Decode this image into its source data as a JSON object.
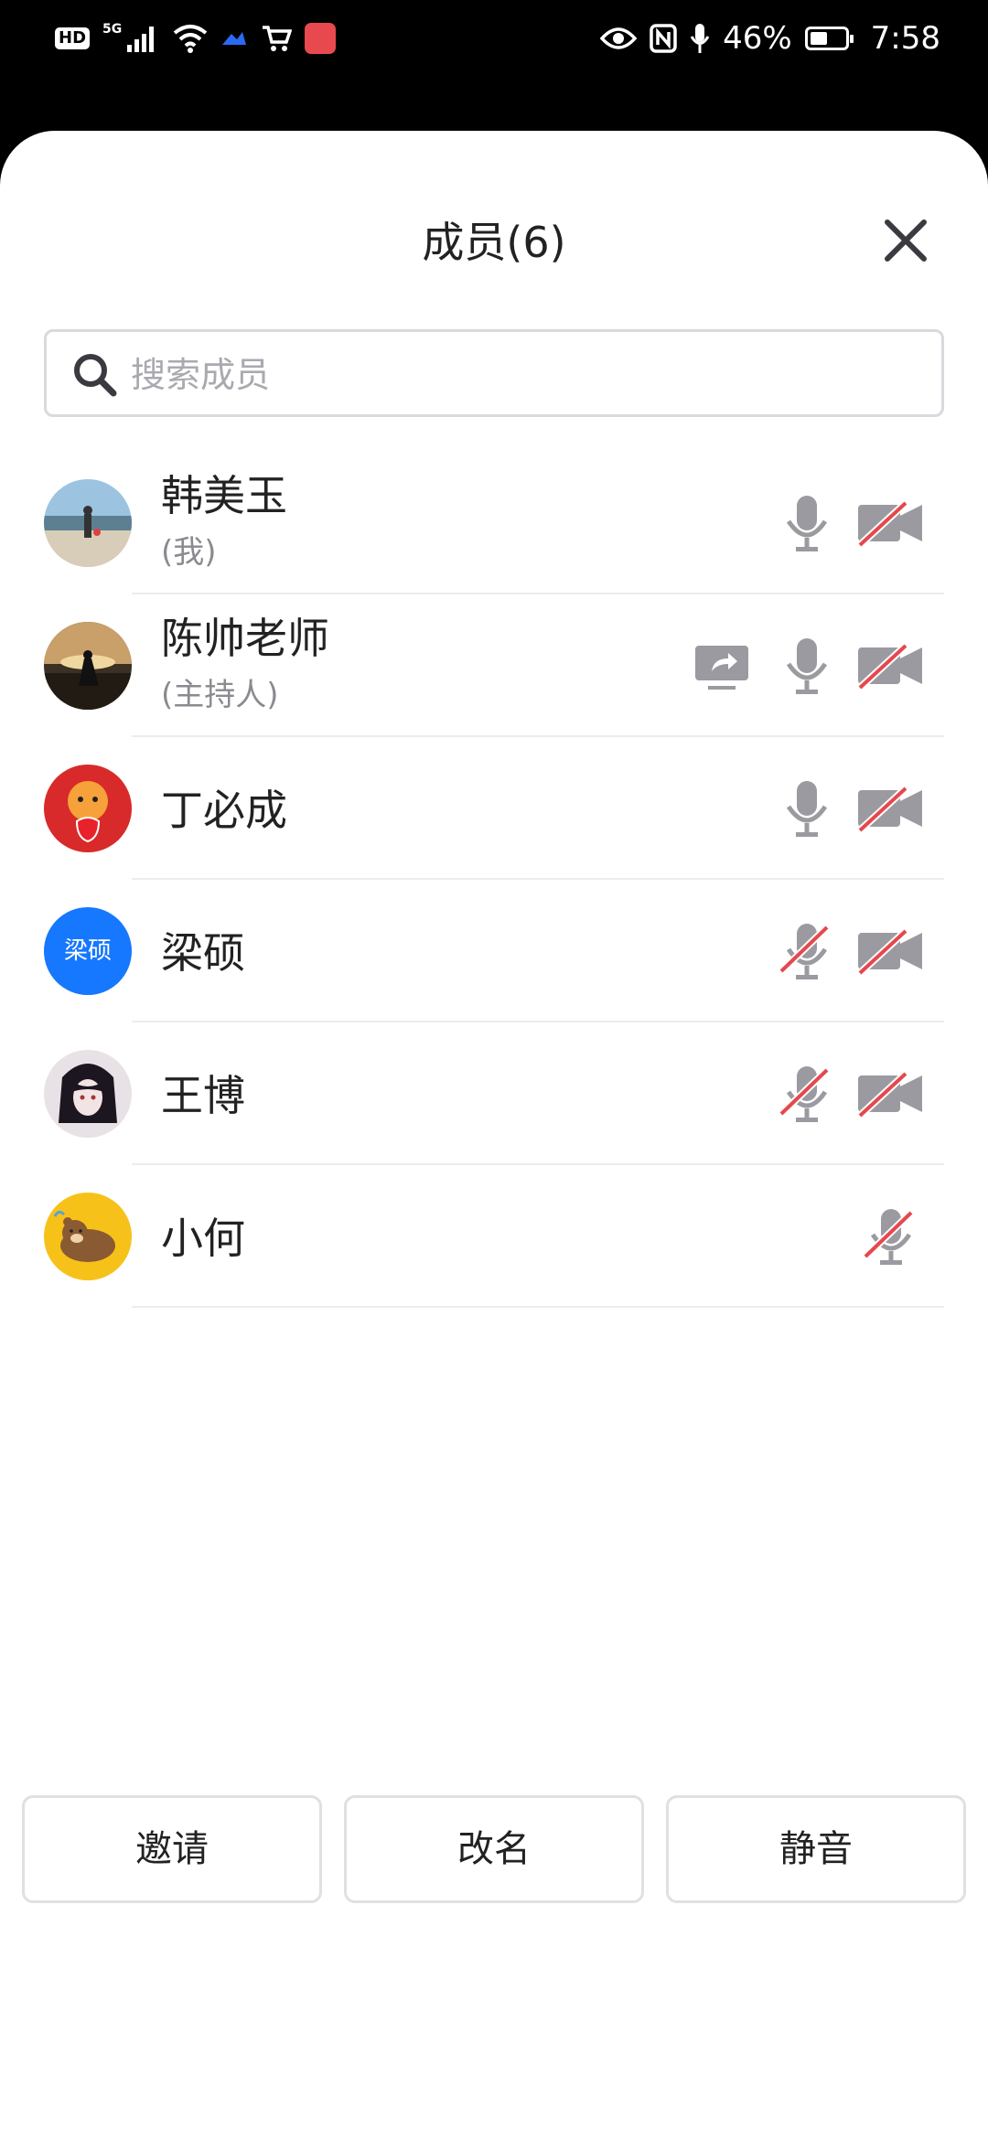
{
  "status_bar": {
    "left_badges": [
      "HD",
      "5G"
    ],
    "battery": "46%",
    "time": "7:58",
    "icons": [
      "hd-icon",
      "signal-icon",
      "wifi-icon",
      "cloud-icon",
      "cart-icon",
      "book-app-icon",
      "eye-icon",
      "nfc-icon",
      "mic-icon",
      "battery-icon"
    ]
  },
  "panel": {
    "title": "成员(6)",
    "search_placeholder": "搜索成员"
  },
  "members": [
    {
      "name": "韩美玉",
      "sub": "(我)",
      "mic": "on",
      "camera": "off",
      "screen_share": false,
      "avatar": "photo"
    },
    {
      "name": "陈帅老师",
      "sub": "(主持人)",
      "mic": "on",
      "camera": "off",
      "screen_share": true,
      "avatar": "photo"
    },
    {
      "name": "丁必成",
      "sub": "",
      "mic": "on",
      "camera": "off",
      "screen_share": false,
      "avatar": "tiger"
    },
    {
      "name": "梁硕",
      "sub": "",
      "mic": "muted",
      "camera": "off",
      "screen_share": false,
      "avatar": "text",
      "avatar_text": "梁硕",
      "avatar_color": "#1677ff"
    },
    {
      "name": "王博",
      "sub": "",
      "mic": "muted",
      "camera": "off",
      "screen_share": false,
      "avatar": "photo"
    },
    {
      "name": "小何",
      "sub": "",
      "mic": "muted",
      "camera": "none",
      "screen_share": false,
      "avatar": "bear"
    }
  ],
  "buttons": {
    "invite": "邀请",
    "rename": "改名",
    "mute": "静音"
  },
  "colors": {
    "accent_blue": "#1677ff",
    "icon_gray": "#9a9aa0",
    "slash_red": "#e5484d"
  }
}
